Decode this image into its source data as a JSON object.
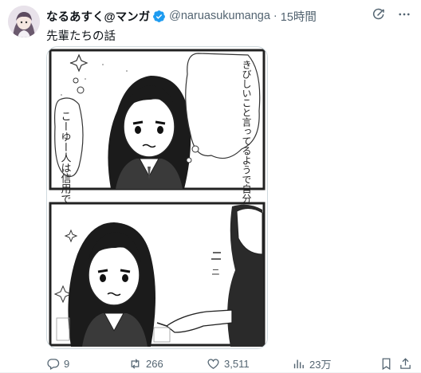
{
  "post": {
    "author_name": "なるあすく@マンガ",
    "handle": "@naruasukumanga",
    "separator": "·",
    "time": "15時間",
    "text": "先輩たちの話"
  },
  "comic": {
    "panel1_bubble": "きびしいこと言ってるようで自分の良さも見てくれてる",
    "panel1_side_text": "こーゆー人は信用できる",
    "panel2_sfx": "ニ"
  },
  "actions": {
    "replies": "9",
    "reposts": "266",
    "likes": "3,511",
    "views": "23万"
  },
  "colors": {
    "verified": "#1d9bf0",
    "muted": "#536471",
    "text": "#0f1419"
  }
}
